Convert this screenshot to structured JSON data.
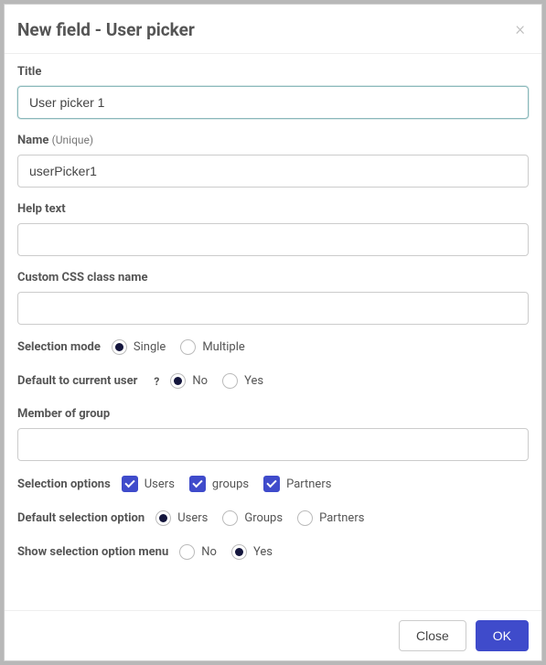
{
  "header": {
    "title": "New field - User picker"
  },
  "fields": {
    "title": {
      "label": "Title",
      "value": "User picker 1"
    },
    "name": {
      "label": "Name",
      "hint": "(Unique)",
      "value": "userPicker1"
    },
    "help_text": {
      "label": "Help text",
      "value": ""
    },
    "css_class": {
      "label": "Custom CSS class name",
      "value": ""
    },
    "selection_mode": {
      "label": "Selection mode",
      "options": {
        "single": "Single",
        "multiple": "Multiple"
      },
      "selected": "single"
    },
    "default_current_user": {
      "label": "Default to current user",
      "options": {
        "no": "No",
        "yes": "Yes"
      },
      "selected": "no"
    },
    "member_of_group": {
      "label": "Member of group",
      "value": ""
    },
    "selection_options": {
      "label": "Selection options",
      "users": {
        "label": "Users",
        "checked": true
      },
      "groups": {
        "label": "groups",
        "checked": true
      },
      "partners": {
        "label": "Partners",
        "checked": true
      }
    },
    "default_selection_option": {
      "label": "Default selection option",
      "options": {
        "users": "Users",
        "groups": "Groups",
        "partners": "Partners"
      },
      "selected": "users"
    },
    "show_menu": {
      "label": "Show selection option menu",
      "options": {
        "no": "No",
        "yes": "Yes"
      },
      "selected": "yes"
    }
  },
  "footer": {
    "close": "Close",
    "ok": "OK"
  }
}
